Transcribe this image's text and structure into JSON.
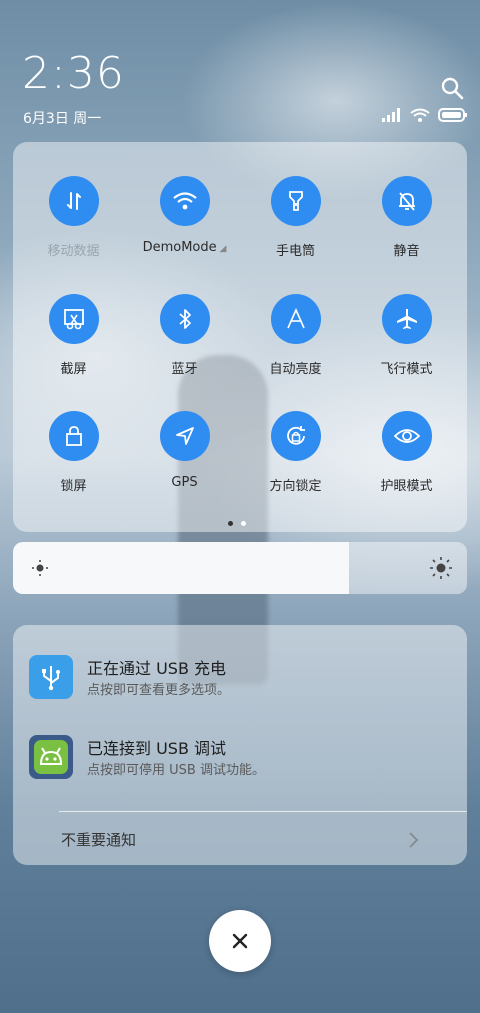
{
  "status": {
    "time": "2:36",
    "date": "6月3日 周一"
  },
  "quick_settings": {
    "tiles": [
      {
        "label": "移动数据",
        "icon": "mobile-data-icon",
        "enabled": false
      },
      {
        "label": "DemoMode",
        "icon": "wifi-icon",
        "enabled": true
      },
      {
        "label": "手电筒",
        "icon": "flashlight-icon",
        "enabled": true
      },
      {
        "label": "静音",
        "icon": "mute-bell-icon",
        "enabled": true
      },
      {
        "label": "截屏",
        "icon": "screenshot-icon",
        "enabled": true
      },
      {
        "label": "蓝牙",
        "icon": "bluetooth-icon",
        "enabled": true
      },
      {
        "label": "自动亮度",
        "icon": "auto-brightness-icon",
        "enabled": true
      },
      {
        "label": "飞行模式",
        "icon": "airplane-icon",
        "enabled": true
      },
      {
        "label": "锁屏",
        "icon": "lock-icon",
        "enabled": true
      },
      {
        "label": "GPS",
        "icon": "gps-icon",
        "enabled": true
      },
      {
        "label": "方向锁定",
        "icon": "rotation-lock-icon",
        "enabled": true
      },
      {
        "label": "护眼模式",
        "icon": "eye-icon",
        "enabled": true
      }
    ],
    "page_count": 2,
    "current_page": 1
  },
  "brightness": {
    "level_fraction": 0.74
  },
  "notifications": [
    {
      "title": "正在通过 USB 充电",
      "body": "点按即可查看更多选项。",
      "icon": "usb-icon",
      "color": "#3a9ee8"
    },
    {
      "title": "已连接到 USB 调试",
      "body": "点按即可停用 USB 调试功能。",
      "icon": "android-icon",
      "color": "#7ac043"
    }
  ],
  "unimportant_label": "不重要通知",
  "colors": {
    "accent": "#2f8cf0"
  }
}
